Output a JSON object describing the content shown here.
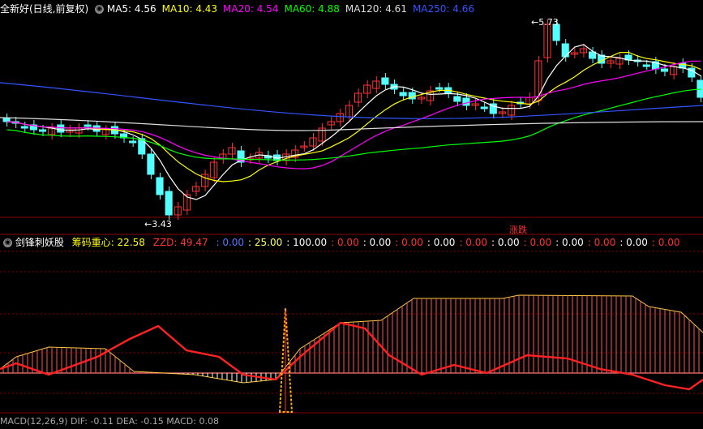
{
  "top_legend": {
    "title": "全新好(日线,前复权)",
    "indicators": [
      {
        "label": "MA5:",
        "value": "4.56",
        "color": "#ffffff"
      },
      {
        "label": "MA10:",
        "value": "4.43",
        "color": "#ffff00"
      },
      {
        "label": "MA20:",
        "value": "4.54",
        "color": "#ff00ff"
      },
      {
        "label": "MA60:",
        "value": "4.88",
        "color": "#00ff00"
      },
      {
        "label": "MA120:",
        "value": "4.61",
        "color": "#dddddd"
      },
      {
        "label": "MA250:",
        "value": "4.66",
        "color": "#3355ff"
      }
    ]
  },
  "price_annotations": {
    "high": "5.73",
    "low": "3.43",
    "badge": "涨跌"
  },
  "panel2": {
    "title": "剑锋刺妖股",
    "chip_label": "筹码重心",
    "chip_value": ": 22.58",
    "zzd_label": "ZZD",
    "zzd_value": ": 49.47",
    "values": [
      {
        "text": ": 0.00",
        "color": "#5577ff"
      },
      {
        "text": ": 25.00",
        "color": "#ffff66"
      },
      {
        "text": ": 100.00",
        "color": "#ffffff"
      },
      {
        "text": ": 0.00",
        "color": "#ff3333"
      },
      {
        "text": ": 0.00",
        "color": "#ffffff"
      },
      {
        "text": ": 0.00",
        "color": "#ff3333"
      },
      {
        "text": ": 0.00",
        "color": "#ffffff"
      },
      {
        "text": ": 0.00",
        "color": "#ff3333"
      },
      {
        "text": ": 0.00",
        "color": "#ffffff"
      },
      {
        "text": ": 0.00",
        "color": "#ff3333"
      },
      {
        "text": ": 0.00",
        "color": "#ffffff"
      },
      {
        "text": ": 0.00",
        "color": "#ff3333"
      },
      {
        "text": ": 0.00",
        "color": "#ffffff"
      },
      {
        "text": ": 0.00",
        "color": "#ff3333"
      }
    ]
  },
  "bottom_header": "MACD(12,26,9)  DIF: -0.11  DEA: -0.15  MACD: 0.08",
  "colors": {
    "up": "#ff3333",
    "down": "#55ffff",
    "grid": "#8b0000"
  }
}
